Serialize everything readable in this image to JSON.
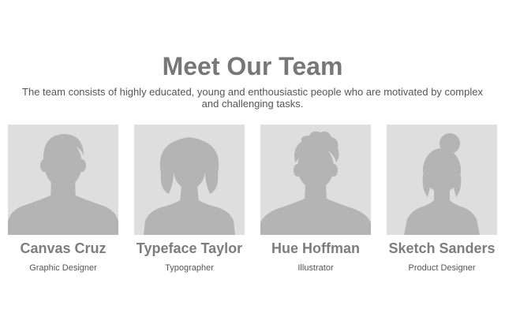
{
  "section": {
    "title": "Meet Our Team",
    "intro": "The team consists of highly educated, young and enthousiastic people who are motivated by complex and challenging tasks."
  },
  "members": [
    {
      "name": "Canvas Cruz",
      "role": "Graphic Designer",
      "avatar_icon": "male-short-hair-silhouette-icon"
    },
    {
      "name": "Typeface Taylor",
      "role": "Typographer",
      "avatar_icon": "female-bob-hair-silhouette-icon"
    },
    {
      "name": "Hue Hoffman",
      "role": "Illustrator",
      "avatar_icon": "male-spiky-hair-silhouette-icon"
    },
    {
      "name": "Sketch Sanders",
      "role": "Product Designer",
      "avatar_icon": "female-bun-hair-silhouette-icon"
    }
  ],
  "colors": {
    "background": "#ffffff",
    "heading": "#777777",
    "body_text": "#555555",
    "photo_bg": "#dedede",
    "silhouette": "#b4b4b4"
  }
}
